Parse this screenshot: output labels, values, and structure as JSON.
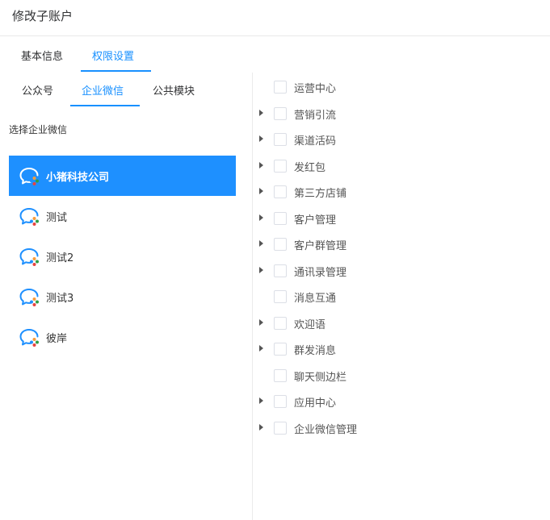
{
  "header": {
    "title": "修改子账户"
  },
  "main_tabs": [
    {
      "label": "基本信息",
      "active": false
    },
    {
      "label": "权限设置",
      "active": true
    }
  ],
  "sub_tabs": [
    {
      "label": "公众号",
      "active": false
    },
    {
      "label": "企业微信",
      "active": true
    },
    {
      "label": "公共模块",
      "active": false
    }
  ],
  "select_label": "选择企业微信",
  "enterprises": [
    {
      "name": "小猪科技公司",
      "selected": true,
      "icon": "wecom-icon"
    },
    {
      "name": "测试",
      "selected": false,
      "icon": "wecom-icon"
    },
    {
      "name": "测试2",
      "selected": false,
      "icon": "wecom-icon"
    },
    {
      "name": "测试3",
      "selected": false,
      "icon": "wecom-icon"
    },
    {
      "name": "彼岸",
      "selected": false,
      "icon": "wecom-icon"
    }
  ],
  "permissions": [
    {
      "label": "运营中心",
      "expandable": false,
      "checked": false
    },
    {
      "label": "营销引流",
      "expandable": true,
      "checked": false
    },
    {
      "label": "渠道活码",
      "expandable": true,
      "checked": false
    },
    {
      "label": "发红包",
      "expandable": true,
      "checked": false
    },
    {
      "label": "第三方店铺",
      "expandable": true,
      "checked": false
    },
    {
      "label": "客户管理",
      "expandable": true,
      "checked": false
    },
    {
      "label": "客户群管理",
      "expandable": true,
      "checked": false
    },
    {
      "label": "通讯录管理",
      "expandable": true,
      "checked": false
    },
    {
      "label": "消息互通",
      "expandable": false,
      "checked": false
    },
    {
      "label": "欢迎语",
      "expandable": true,
      "checked": false
    },
    {
      "label": "群发消息",
      "expandable": true,
      "checked": false
    },
    {
      "label": "聊天侧边栏",
      "expandable": false,
      "checked": false
    },
    {
      "label": "应用中心",
      "expandable": true,
      "checked": false
    },
    {
      "label": "企业微信管理",
      "expandable": true,
      "checked": false
    }
  ],
  "colors": {
    "accent": "#1890ff",
    "selected_bg": "#1e90ff"
  }
}
